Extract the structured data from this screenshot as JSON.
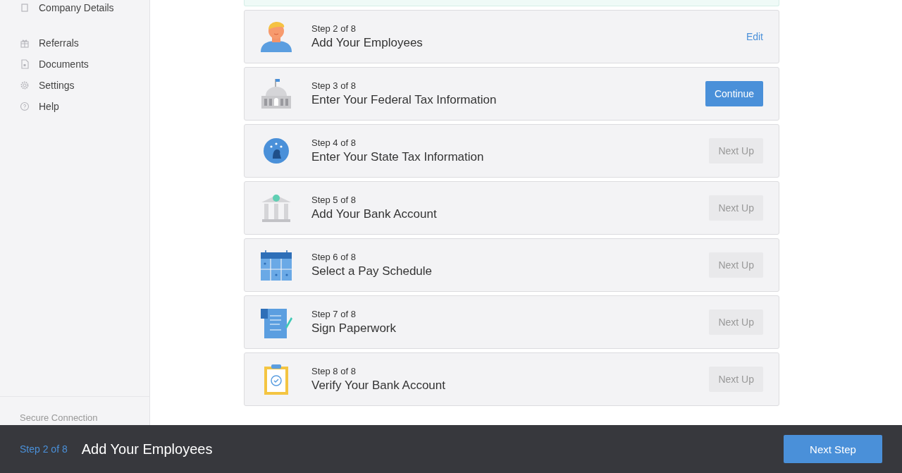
{
  "sidebar": {
    "top_items": [
      {
        "label": "Company Details"
      }
    ],
    "items": [
      {
        "label": "Referrals"
      },
      {
        "label": "Documents"
      },
      {
        "label": "Settings"
      },
      {
        "label": "Help"
      }
    ],
    "footer_text": "Secure Connection"
  },
  "steps": [
    {
      "step": "Step 2 of 8",
      "title": "Add Your Employees",
      "action": {
        "kind": "edit",
        "label": "Edit"
      }
    },
    {
      "step": "Step 3 of 8",
      "title": "Enter Your Federal Tax Information",
      "action": {
        "kind": "continue",
        "label": "Continue"
      }
    },
    {
      "step": "Step 4 of 8",
      "title": "Enter Your State Tax Information",
      "action": {
        "kind": "next",
        "label": "Next Up"
      }
    },
    {
      "step": "Step 5 of 8",
      "title": "Add Your Bank Account",
      "action": {
        "kind": "next",
        "label": "Next Up"
      }
    },
    {
      "step": "Step 6 of 8",
      "title": "Select a Pay Schedule",
      "action": {
        "kind": "next",
        "label": "Next Up"
      }
    },
    {
      "step": "Step 7 of 8",
      "title": "Sign Paperwork",
      "action": {
        "kind": "next",
        "label": "Next Up"
      }
    },
    {
      "step": "Step 8 of 8",
      "title": "Verify Your Bank Account",
      "action": {
        "kind": "next",
        "label": "Next Up"
      }
    }
  ],
  "footer": {
    "step": "Step 2 of 8",
    "title": "Add Your Employees",
    "button": "Next Step"
  }
}
